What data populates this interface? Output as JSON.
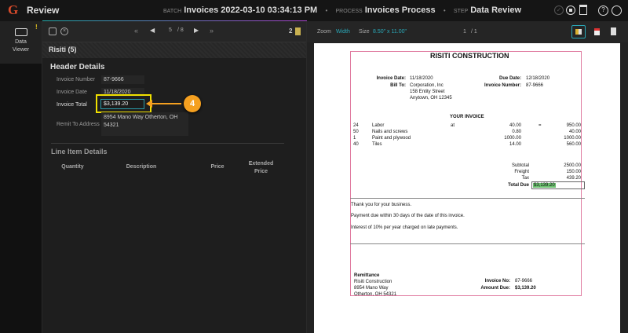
{
  "app": {
    "title": "Review",
    "logo": "G",
    "batch_label": "BATCH",
    "batch": "Invoices 2022-03-10 03:34:13 PM",
    "process_label": "PROCESS",
    "process": "Invoices Process",
    "step_label": "STEP",
    "step": "Data Review",
    "separator": "•"
  },
  "sidebar": {
    "item_label_1": "Data",
    "item_label_2": "Viewer",
    "badge": "!"
  },
  "toolbar": {
    "page": "5",
    "total": "/ 8",
    "doc_count": "2"
  },
  "left": {
    "section": "Risiti (5)",
    "header_title": "Header Details",
    "fields": [
      {
        "label": "Invoice Number",
        "value": "87-9666"
      },
      {
        "label": "Invoice Date",
        "value": "11/18/2020"
      },
      {
        "label": "Invoice Total",
        "value": "$3,139.20"
      },
      {
        "label": "Remit To Address",
        "value": "8954 Mano Way Otherton, OH 54321"
      }
    ],
    "line_title": "Line Item Details",
    "columns": [
      "Quantity",
      "Description",
      "Price",
      "Extended Price"
    ],
    "callout": "4"
  },
  "viewer": {
    "zoom_label": "Zoom",
    "zoom": "Width",
    "size_label": "Size",
    "size": "8.50\" x 11.00\"",
    "page": "1",
    "pages": "/ 1"
  },
  "doc": {
    "company": "RISITI CONSTRUCTION",
    "invoice_date_label": "Invoice Date:",
    "invoice_date": "11/18/2020",
    "bill_to_label": "Bill To:",
    "bill_to": [
      "Corporation, Inc",
      "158 Entity Street",
      "Anytown, OH 12345"
    ],
    "due_date_label": "Due Date:",
    "due_date": "12/18/2020",
    "invoice_number_label": "Invoice Number:",
    "invoice_number": "87-9666",
    "your_invoice": "YOUR INVOICE",
    "lines": [
      {
        "qty": "24",
        "desc": "Labor",
        "at": "at",
        "price": "40.00",
        "eq": "=",
        "ext": "950.00"
      },
      {
        "qty": "50",
        "desc": "Nails and screws",
        "at": "",
        "price": "0.80",
        "eq": "",
        "ext": "40.00"
      },
      {
        "qty": "1",
        "desc": "Paint and plywood",
        "at": "",
        "price": "1000.00",
        "eq": "",
        "ext": "1000.00"
      },
      {
        "qty": "40",
        "desc": "Tiles",
        "at": "",
        "price": "14.00",
        "eq": "",
        "ext": "560.00"
      }
    ],
    "subtotal_label": "Subtotal",
    "subtotal": "2500.00",
    "freight_label": "Freight",
    "freight": "150.00",
    "tax_label": "Tax",
    "tax": "439.20",
    "total_label": "Total Due",
    "total": "$3,139.20",
    "notes": [
      "Thank you for your business.",
      "Payment due within 30 days of the date of this invoice.",
      "Interest of 10% per year charged on late payments."
    ],
    "remit_title": "Remittance",
    "remit": [
      "Risiti Construction",
      "8954 Mano Way",
      "Otherton, OH 54321"
    ],
    "inv_no_label": "Invoice No:",
    "inv_no": "87-9666",
    "amount_due_label": "Amount Due:",
    "amount_due": "$3,139.20"
  },
  "colors": {
    "accent": "#2aa8b8",
    "highlight": "#f0e000",
    "callout": "#f5a020",
    "doc_border": "#e07ba0"
  }
}
